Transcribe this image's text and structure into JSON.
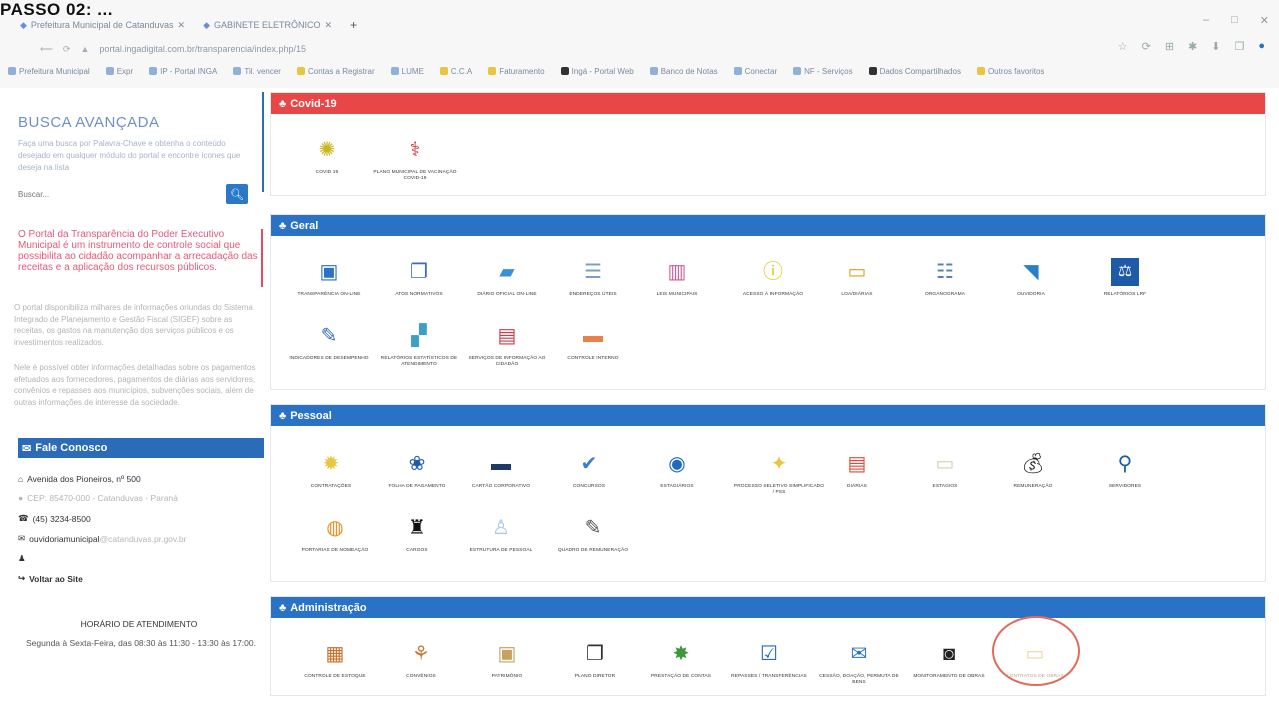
{
  "caption": "PASSO 02: ...",
  "browser": {
    "tabs": [
      {
        "label": "Prefeitura Municipal de Catanduvas"
      },
      {
        "label": "GABINETE ELETRÔNICO"
      }
    ],
    "new_tab": "+",
    "window_controls": [
      "–",
      "□",
      "✕"
    ],
    "url": "portal.ingadigital.com.br/transparencia/index.php/15",
    "address_icons": [
      "☆",
      "⟳",
      "⊞",
      "✱",
      "⬇",
      "❐",
      "●"
    ],
    "bookmarks": [
      "Prefeitura Municipal",
      "Expr",
      "IP - Portal INGA",
      "Til. vencer",
      "Contas a Registrar",
      "LUME",
      "C.C.A",
      "Faturamento",
      "Ingá - Portal Web",
      "Banco de Notas",
      "Conectar",
      "NF - Serviços",
      "Dados Compartilhados",
      "Outros favoritos"
    ]
  },
  "sidebar": {
    "title": "BUSCA AVANÇADA",
    "description": "Faça uma busca por Palavra-Chave e obtenha o conteúdo desejado em qualquer módulo do portal e encontre ícones que deseja na lista",
    "search_placeholder": "Buscar...",
    "search_icon": "search-icon",
    "intro_red": "O Portal da Transparência do Poder Executivo Municipal é um instrumento de controle social que possibilita ao cidadão acompanhar a arrecadação das receitas e a aplicação dos recursos públicos.",
    "paragraph1": "O portal disponibiliza milhares de informações oriundas do Sistema Integrado de Planejamento e Gestão Fiscal (SIGEF) sobre as receitas, os gastos na manutenção dos serviços públicos e os investimentos realizados.",
    "paragraph2": "Nele é possível obter informações detalhadas sobre os pagamentos efetuados aos fornecedores, pagamentos de diárias aos servidores, convênios e repasses aos municípios, subvenções sociais, além de outras informações de interesse da sociedade.",
    "contact": {
      "heading": "Fale Conosco",
      "address": "Avenida dos Pioneiros, nº 500",
      "cep": "CEP: 85470-000 - Catanduvas - Paraná",
      "phone": "(45) 3234-8500",
      "email_user": "ouvidoriamunicipal",
      "email_domain": "@catanduvas.pr.gov.br",
      "back_link": "Voltar ao Site"
    },
    "hours_title": "HORÁRIO DE ATENDIMENTO",
    "hours_text": "Segunda à Sexta-Feira, das 08:30 às 11:30 - 13:30 às 17:00."
  },
  "sections": [
    {
      "title": "Covid-19",
      "color": "#e94747",
      "items": [
        {
          "label": "COVID 19",
          "icon": "virus-icon"
        },
        {
          "label": "Plano Municipal de Vacinação COVID-19",
          "icon": "vaccine-icon"
        }
      ]
    },
    {
      "title": "Geral",
      "color": "#2a72c6",
      "items": [
        {
          "label": "TRANSPARÊNCIA ON-LINE",
          "icon": "monitor-icon"
        },
        {
          "label": "ATOS NORMATIVOS",
          "icon": "documents-icon"
        },
        {
          "label": "DIÁRIO OFICIAL ON-LINE",
          "icon": "folder-search-icon"
        },
        {
          "label": "ENDEREÇOS ÚTEIS",
          "icon": "address-book-icon"
        },
        {
          "label": "LEIS MUNICIPAIS",
          "icon": "law-books-icon"
        },
        {
          "label": "ACESSO À INFORMAÇÃO",
          "icon": "info-icon"
        },
        {
          "label": "LOA/DIÁRIAS",
          "icon": "open-book-icon"
        },
        {
          "label": "ORGANOGRAMA",
          "icon": "org-chart-icon"
        },
        {
          "label": "OUVIDORIA",
          "icon": "megaphone-icon"
        },
        {
          "label": "RELATÓRIOS LRF",
          "icon": "scales-icon"
        },
        {
          "label": "INDICADORES DE DESEMPENHO",
          "icon": "tools-icon"
        },
        {
          "label": "RELATÓRIOS ESTATÍSTICOS DE ATENDIMENTO",
          "icon": "statistics-icon"
        },
        {
          "label": "SERVIÇOS DE INFORMAÇÃO AO CIDADÃO",
          "icon": "store-icon"
        },
        {
          "label": "CONTROLE INTERNO",
          "icon": "control-icon"
        }
      ]
    },
    {
      "title": "Pessoal",
      "color": "#2a72c6",
      "items": [
        {
          "label": "CONTRATAÇÕES",
          "icon": "contract-icon"
        },
        {
          "label": "FOLHA DE PAGAMENTO",
          "icon": "payroll-icon"
        },
        {
          "label": "CARTÃO CORPORATIVO",
          "icon": "credit-card-icon"
        },
        {
          "label": "CONCURSOS",
          "icon": "checkmark-icon"
        },
        {
          "label": "ESTAGIÁRIOS",
          "icon": "badge-icon"
        },
        {
          "label": "PROCESSO SELETIVO SIMPLIFICADO / PSS",
          "icon": "process-icon"
        },
        {
          "label": "DIÁRIAS",
          "icon": "spreadsheet-icon"
        },
        {
          "label": "ESTAGIOS",
          "icon": "intern-icon"
        },
        {
          "label": "REMUNERAÇÃO",
          "icon": "money-bag-icon"
        },
        {
          "label": "SERVIDORES",
          "icon": "people-search-icon"
        },
        {
          "label": "PORTARIAS DE NOMEAÇÃO",
          "icon": "appointment-icon"
        },
        {
          "label": "CARGOS",
          "icon": "graduate-icon"
        },
        {
          "label": "ESTRUTURA DE PESSOAL",
          "icon": "personnel-icon"
        },
        {
          "label": "QUADRO DE REMUNERAÇÃO",
          "icon": "clipboard-edit-icon"
        }
      ]
    },
    {
      "title": "Administração",
      "color": "#2a72c6",
      "items": [
        {
          "label": "CONTROLE DE ESTOQUE",
          "icon": "boxes-icon"
        },
        {
          "label": "CONVÊNIOS",
          "icon": "handshake-icon"
        },
        {
          "label": "PATRIMÔNIO",
          "icon": "package-icon"
        },
        {
          "label": "PLANO DIRETOR",
          "icon": "document-icon"
        },
        {
          "label": "PRESTAÇÃO DE CONTAS",
          "icon": "accounts-icon"
        },
        {
          "label": "REPASSES / TRANSFERÊNCIAS",
          "icon": "transfer-icon"
        },
        {
          "label": "CESSÃO, DOAÇÃO, PERMUTA DE BENS",
          "icon": "donation-icon"
        },
        {
          "label": "MONITORAMENTO DE OBRAS",
          "icon": "camera-icon"
        },
        {
          "label": "CONTRATOS DE OBRAS",
          "icon": "works-icon"
        }
      ]
    }
  ]
}
